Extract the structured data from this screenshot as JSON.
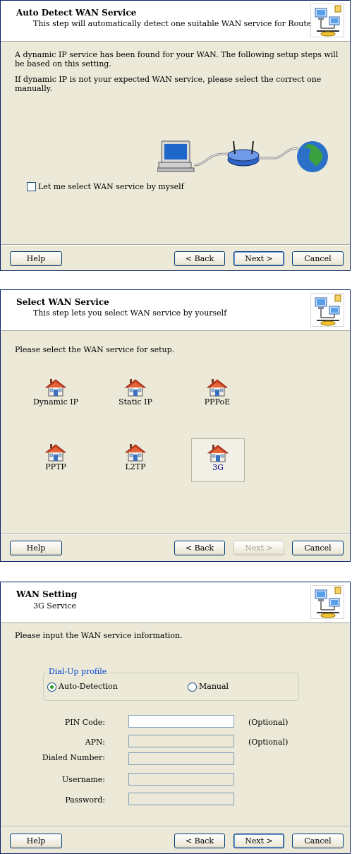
{
  "dialog1": {
    "title": "Auto Detect WAN Service",
    "subtitle": "This step will automatically detect one suitable WAN service for Router",
    "para1": "A dynamic IP service has been found for your WAN. The following setup steps will be based on this setting.",
    "para2": "If dynamic IP is not your expected WAN service, please select the correct one manually.",
    "checkbox_label": "Let me select WAN service by myself",
    "buttons": {
      "help": "Help",
      "back": "< Back",
      "next": "Next >",
      "cancel": "Cancel"
    }
  },
  "dialog2": {
    "title": "Select WAN Service",
    "subtitle": "This step lets you select WAN service by yourself",
    "prompt": "Please select the WAN service for setup.",
    "services": [
      "Dynamic IP",
      "Static IP",
      "PPPoE",
      "PPTP",
      "L2TP",
      "3G"
    ],
    "selected_service": "3G",
    "buttons": {
      "help": "Help",
      "back": "< Back",
      "next": "Next >",
      "cancel": "Cancel"
    }
  },
  "dialog3": {
    "title": "WAN Setting",
    "subtitle": "3G Service",
    "prompt": "Please input the WAN service information.",
    "group_title": "Dial-Up profile",
    "radio_auto": "Auto-Detection",
    "radio_manual": "Manual",
    "fields": {
      "pin": "PIN Code:",
      "apn": "APN:",
      "dialed": "Dialed Number:",
      "username": "Username:",
      "password": "Password:"
    },
    "optional": "(Optional)",
    "buttons": {
      "help": "Help",
      "back": "< Back",
      "next": "Next >",
      "cancel": "Cancel"
    }
  },
  "colors": {
    "dialog_bg": "#ece9d8",
    "border": "#0a246a",
    "group_title": "#0046d5"
  }
}
